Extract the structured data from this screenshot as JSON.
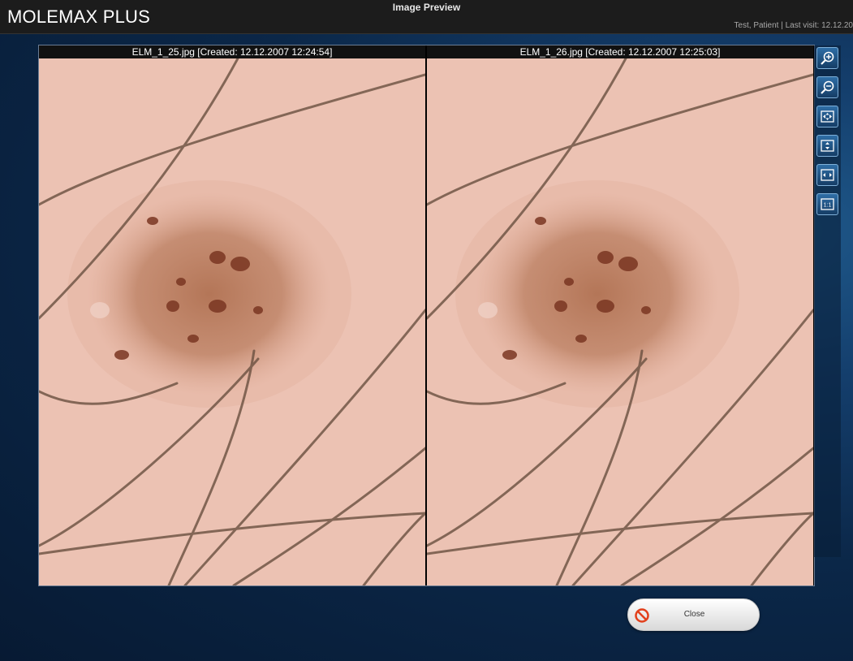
{
  "app": {
    "name": "MOLEMAX PLUS",
    "window_title": "Image Preview",
    "patient_info": "Test, Patient | Last visit: 12.12.20"
  },
  "panes": [
    {
      "caption": "ELM_1_25.jpg [Created: 12.12.2007 12:24:54]"
    },
    {
      "caption": "ELM_1_26.jpg [Created: 12.12.2007 12:25:03]"
    }
  ],
  "toolbar": {
    "tools": [
      {
        "icon": "zoom-in-icon"
      },
      {
        "icon": "zoom-out-icon"
      },
      {
        "icon": "fit-image-icon"
      },
      {
        "icon": "fit-height-icon"
      },
      {
        "icon": "fit-width-icon"
      },
      {
        "icon": "actual-size-icon",
        "label": "1:1"
      }
    ]
  },
  "close_button": {
    "label": "Close",
    "icon": "ban-icon"
  },
  "colors": {
    "skin": "#ecc2b3",
    "lesion": "#b6795c",
    "hair": "#6a5040",
    "topbar": "#1c1c1c",
    "background": "#0b2748"
  }
}
